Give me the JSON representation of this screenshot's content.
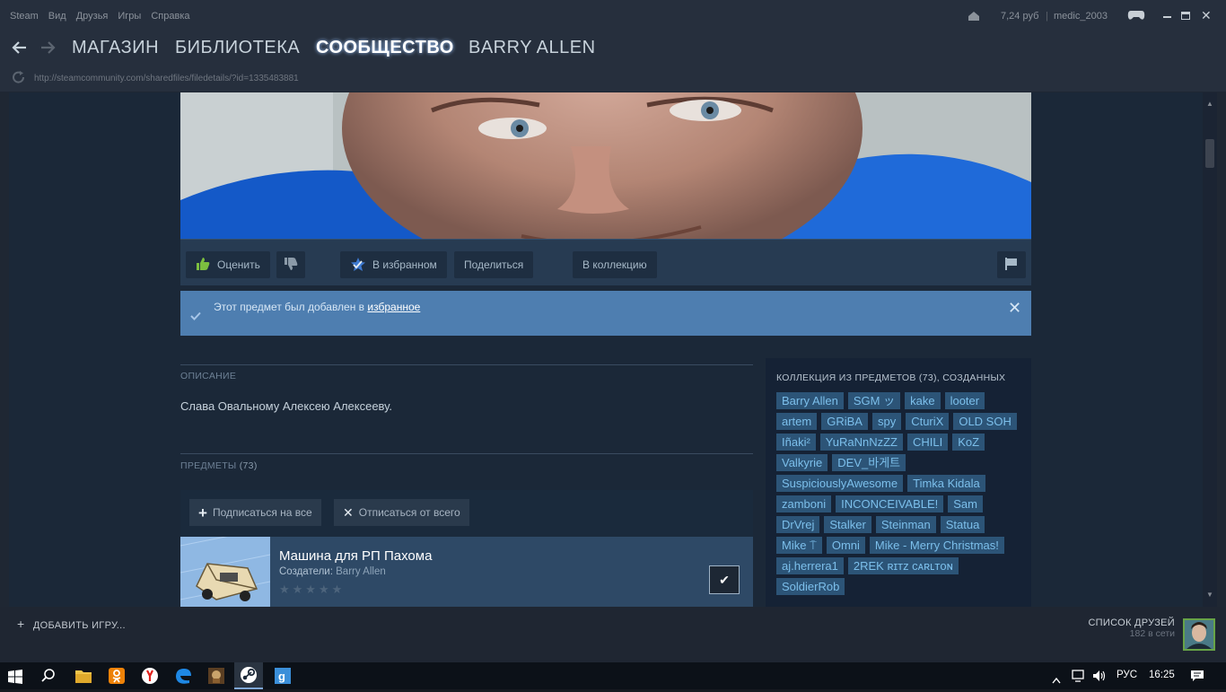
{
  "menubar": {
    "items": [
      "Steam",
      "Вид",
      "Друзья",
      "Игры",
      "Справка"
    ],
    "balance": "7,24 руб",
    "separator": "|",
    "username": "medic_2003"
  },
  "nav": {
    "tabs": [
      "МАГАЗИН",
      "БИБЛИОТЕКА",
      "СООБЩЕСТВО",
      "BARRY ALLEN"
    ],
    "active_tab": "СООБЩЕСТВО"
  },
  "url": "http://steamcommunity.com/sharedfiles/filedetails/?id=1335483881",
  "actions": {
    "rate": "Оценить",
    "favorite": "В избранном",
    "share": "Поделиться",
    "collection": "В коллекцию"
  },
  "notification": {
    "text": "Этот предмет был добавлен в",
    "link": "избранное"
  },
  "description": {
    "label": "ОПИСАНИЕ",
    "text": "Слава Овальному Алексею Алексееву."
  },
  "items": {
    "label": "ПРЕДМЕТЫ",
    "count": "(73)",
    "subscribe_all": "Подписаться на все",
    "unsubscribe_all": "Отписаться от всего",
    "first_item": {
      "title": "Машина для РП Пахома",
      "creators_label": "Создатели:",
      "creator": "Barry Allen"
    }
  },
  "collection": {
    "header": "КОЛЛЕКЦИЯ ИЗ ПРЕДМЕТОВ (73), СОЗДАННЫХ",
    "tags": [
      "Barry Allen",
      "SGM ッ",
      "kake",
      "looter",
      "artem",
      "GRiBA",
      "spy",
      "CturiX",
      "OLD SOH",
      "Iñaki²",
      "YuRaNnNzZZ",
      "CHILI",
      "KoZ",
      "Valkyrie",
      "DEV_바게트",
      "SuspiciouslyAwesome",
      "Timka Kidala",
      "zamboni",
      "INCONCEIVABLE!",
      "Sam",
      "DrVrej",
      "Stalker",
      "Steinman",
      "Statua",
      "Mike ⍑",
      "Omni",
      "Mike - Merry Christmas!",
      "aj.herrera1",
      "2REK ʀɪᴛᴢ ᴄᴀʀʟᴛᴏɴ",
      "SoldierRob"
    ]
  },
  "footer": {
    "add_game": "ДОБАВИТЬ ИГРУ...",
    "friends_list": "СПИСОК ДРУЗЕЙ",
    "online": "182 в сети"
  },
  "taskbar": {
    "lang": "РУС",
    "time": "16:25"
  },
  "colors": {
    "accent": "#4e7eb0",
    "tag_bg": "#2c5477",
    "tag_text": "#7cbfeb"
  }
}
